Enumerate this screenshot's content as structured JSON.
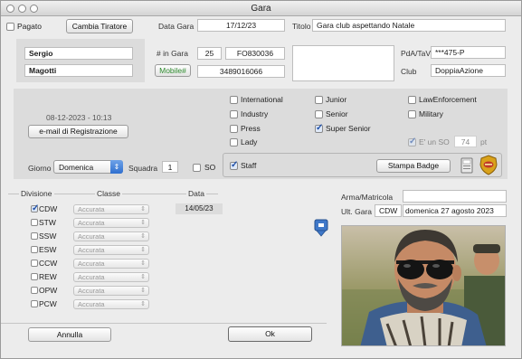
{
  "window": {
    "title": "Gara"
  },
  "top": {
    "pagato_label": "Pagato",
    "cambia_tiratore_label": "Cambia Tiratore",
    "data_gara_label": "Data Gara",
    "data_gara_value": "17/12/23",
    "titolo_label": "Titolo",
    "titolo_value": "Gara club aspettando Natale"
  },
  "shooter": {
    "first_name": "Sergio",
    "last_name": "Magotti",
    "num_in_gara_label": "# in Gara",
    "num_in_gara_value": "25",
    "code_value": "FO830036",
    "mobile_label": "Mobile#",
    "mobile_value": "3489016066",
    "pda_label": "PdA/TaV",
    "pda_value": "***475-P",
    "club_label": "Club",
    "club_value": "DoppiaAzione"
  },
  "registration": {
    "datetime": "08-12-2023 - 10:13",
    "email_button_label": "e-mail di Registrazione"
  },
  "categories": [
    {
      "label": "International",
      "checked": false
    },
    {
      "label": "Industry",
      "checked": false
    },
    {
      "label": "Press",
      "checked": false
    },
    {
      "label": "Lady",
      "checked": false
    },
    {
      "label": "Junior",
      "checked": false
    },
    {
      "label": "Senior",
      "checked": false
    },
    {
      "label": "Super Senior",
      "checked": true
    },
    {
      "label": "LawEnforcement",
      "checked": false
    },
    {
      "label": "Military",
      "checked": false
    }
  ],
  "so": {
    "e_un_so_label": "E' un SO",
    "pt_value": "74",
    "pt_label": "pt"
  },
  "giorno": {
    "label": "Giorno",
    "value": "Domenica",
    "squadra_label": "Squadra",
    "squadra_value": "1",
    "so_label": "SO",
    "staff_label": "Staff",
    "stampa_badge_label": "Stampa Badge"
  },
  "divisions": {
    "header_divisione": "Divisione",
    "header_classe": "Classe",
    "header_data": "Data",
    "rows": [
      {
        "name": "CDW",
        "checked": true,
        "classe": "Accurata",
        "date": "14/05/23"
      },
      {
        "name": "STW",
        "checked": false,
        "classe": "Accurata",
        "date": ""
      },
      {
        "name": "SSW",
        "checked": false,
        "classe": "Accurata",
        "date": ""
      },
      {
        "name": "ESW",
        "checked": false,
        "classe": "Accurata",
        "date": ""
      },
      {
        "name": "CCW",
        "checked": false,
        "classe": "Accurata",
        "date": ""
      },
      {
        "name": "REW",
        "checked": false,
        "classe": "Accurata",
        "date": ""
      },
      {
        "name": "OPW",
        "checked": false,
        "classe": "Accurata",
        "date": ""
      },
      {
        "name": "PCW",
        "checked": false,
        "classe": "Accurata",
        "date": ""
      }
    ]
  },
  "right": {
    "arma_label": "Arma/Matricola",
    "arma_value": "",
    "ult_gara_label": "Ult. Gara",
    "ult_gara_div": "CDW",
    "ult_gara_date": "domenica 27 agosto 2023"
  },
  "footer": {
    "annulla_label": "Annulla",
    "ok_label": "Ok"
  },
  "icons": {
    "badge": "police-badge-icon",
    "printer": "printer-icon",
    "download": "download-icon"
  },
  "colors": {
    "mobile_label_text": "#2e8b2e",
    "panel": "#dcdcdc",
    "badge_gold": "#d9a21b",
    "badge_red": "#c0392b"
  }
}
